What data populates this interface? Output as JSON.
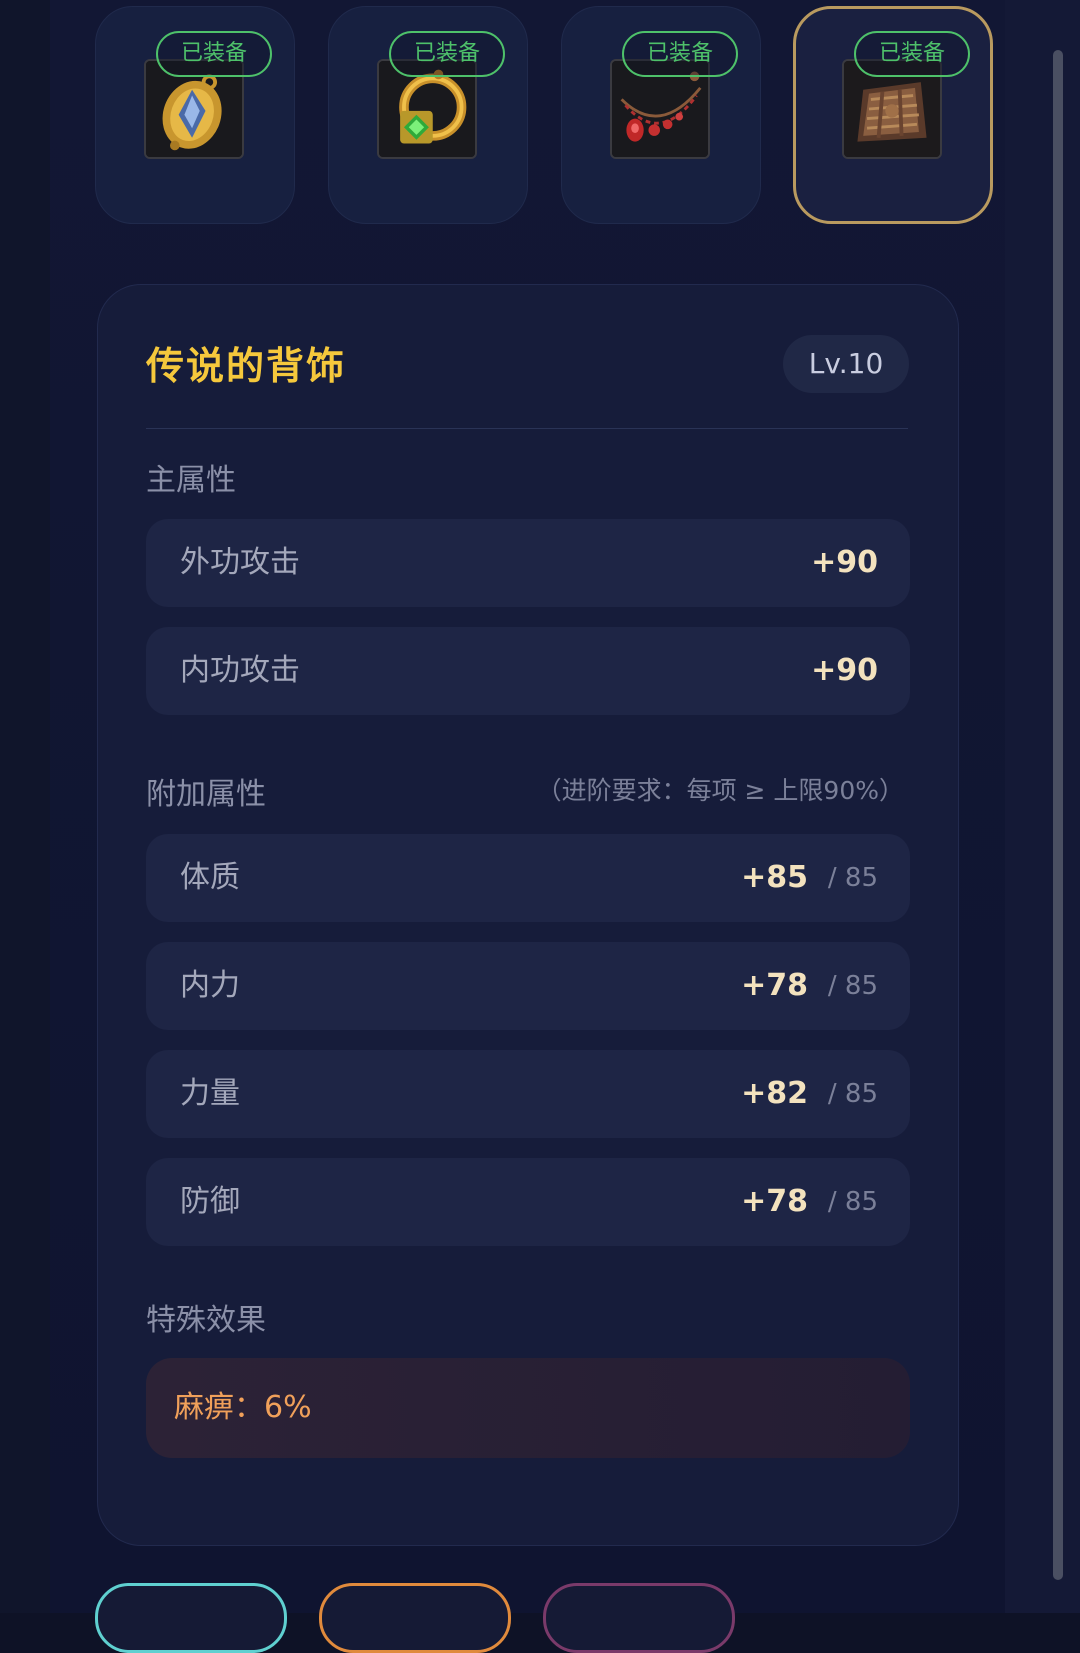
{
  "equipment": {
    "badge_label": "已装备",
    "slots": [
      {
        "icon": "gold-blue-gem-amulet-icon",
        "selected": false
      },
      {
        "icon": "green-gem-ring-icon",
        "selected": false
      },
      {
        "icon": "red-gem-necklace-icon",
        "selected": false
      },
      {
        "icon": "bronze-back-ornament-icon",
        "selected": true
      }
    ]
  },
  "item": {
    "name": "传说的背饰",
    "level": "Lv.10",
    "name_color": "#f5c83c"
  },
  "main_attributes": {
    "label": "主属性",
    "rows": [
      {
        "name": "外功攻击",
        "value": "+90"
      },
      {
        "name": "内功攻击",
        "value": "+90"
      }
    ]
  },
  "extra_attributes": {
    "label": "附加属性",
    "note": "（进阶要求：每项 ≥ 上限90%）",
    "rows": [
      {
        "name": "体质",
        "value": "+85",
        "max": "/ 85"
      },
      {
        "name": "内力",
        "value": "+78",
        "max": "/ 85"
      },
      {
        "name": "力量",
        "value": "+82",
        "max": "/ 85"
      },
      {
        "name": "防御",
        "value": "+78",
        "max": "/ 85"
      }
    ]
  },
  "special_effect": {
    "label": "特殊效果",
    "text": "麻痹：6%",
    "color": "#f0a05a"
  },
  "bottom_buttons": [
    {
      "border_color": "#5fd0d0"
    },
    {
      "border_color": "#e08a3c"
    },
    {
      "border_color": "#7a3a6a"
    }
  ]
}
